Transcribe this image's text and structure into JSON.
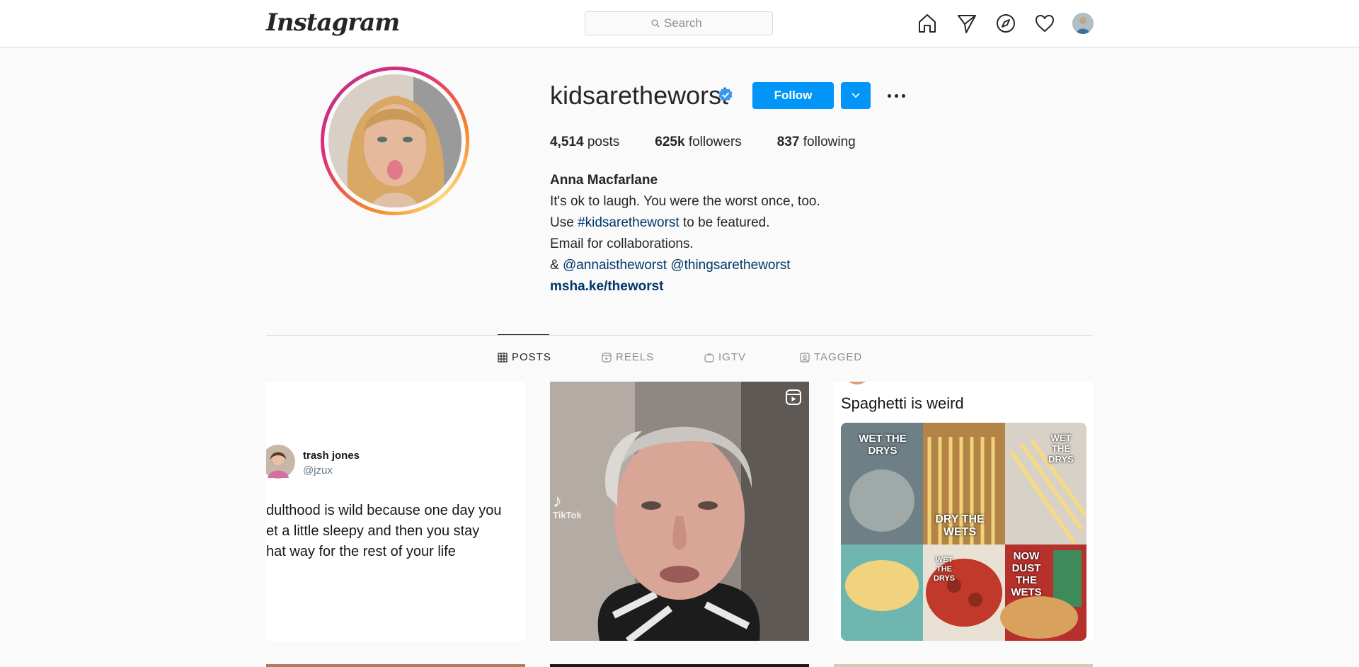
{
  "nav": {
    "logo": "Instagram",
    "search_placeholder": "Search",
    "icons": [
      "home-icon",
      "direct-icon",
      "explore-icon",
      "activity-icon",
      "profile-avatar"
    ]
  },
  "profile": {
    "username": "kidsaretheworst",
    "verified": true,
    "follow_label": "Follow",
    "stats": [
      {
        "value": "4,514",
        "label": "posts"
      },
      {
        "value": "625k",
        "label": "followers"
      },
      {
        "value": "837",
        "label": "following"
      }
    ],
    "bio": {
      "name": "Anna Macfarlane",
      "line1": "It's ok to laugh. You were the worst once, too.",
      "line2_prefix": "Use ",
      "line2_tag": "#kidsaretheworst",
      "line2_suffix": " to be featured.",
      "line3": "Email for collaborations.",
      "line4_prefix": "& ",
      "line4_mention1": "@annaistheworst",
      "line4_mention2": "@thingsaretheworst",
      "url": "msha.ke/theworst"
    }
  },
  "tabs": [
    {
      "label": "POSTS",
      "icon": "grid-icon",
      "active": true
    },
    {
      "label": "REELS",
      "icon": "reels-icon",
      "active": false
    },
    {
      "label": "IGTV",
      "icon": "igtv-icon",
      "active": false
    },
    {
      "label": "TAGGED",
      "icon": "tagged-icon",
      "active": false
    }
  ],
  "posts": [
    {
      "type": "tweet",
      "author": "trash jones",
      "handle": "@jzux",
      "text_lines": [
        "dulthood is wild because one day you",
        "et a little sleepy and then you stay",
        "hat way for the rest of your life"
      ]
    },
    {
      "type": "reel",
      "watermark": "TikTok"
    },
    {
      "type": "meme",
      "caption": "Spaghetti is weird",
      "tiles": [
        "WET THE DRYS",
        "DRY THE WETS",
        "WET THE DRYS",
        "WET THE DRYS",
        "NOW DUST THE WETS"
      ]
    }
  ],
  "colors": {
    "accent": "#0095f6",
    "link": "#00376b",
    "border": "#dbdbdb",
    "background": "#fafafa"
  }
}
